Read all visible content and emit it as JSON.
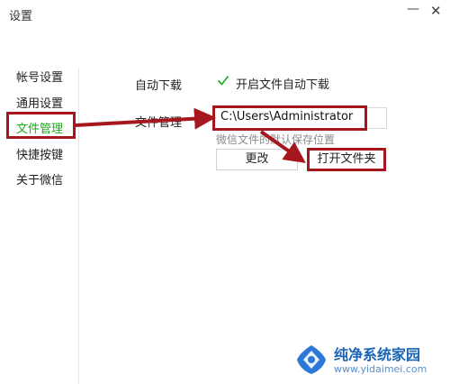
{
  "window": {
    "title": "设置",
    "minimize_glyph": "—",
    "close_glyph": "✕"
  },
  "sidebar": {
    "items": [
      {
        "label": "帐号设置",
        "active": false
      },
      {
        "label": "通用设置",
        "active": false
      },
      {
        "label": "文件管理",
        "active": true
      },
      {
        "label": "快捷按键",
        "active": false
      },
      {
        "label": "关于微信",
        "active": false
      }
    ]
  },
  "content": {
    "auto_download": {
      "label": "自动下载",
      "checkbox_label": "开启文件自动下载",
      "checked": true
    },
    "file_management": {
      "label": "文件管理",
      "path_value": "C:\\Users\\Administrator",
      "hint": "微信文件的默认保存位置",
      "change_button": "更改",
      "open_folder_button": "打开文件夹"
    }
  },
  "annotations": {
    "color": "#a5161d"
  },
  "watermark": {
    "title": "纯净系统家园",
    "url": "www.yidaimei.com"
  },
  "colors": {
    "accent_green": "#1aad19",
    "annotation_red": "#a5161d",
    "watermark_blue": "#1a64b4"
  }
}
